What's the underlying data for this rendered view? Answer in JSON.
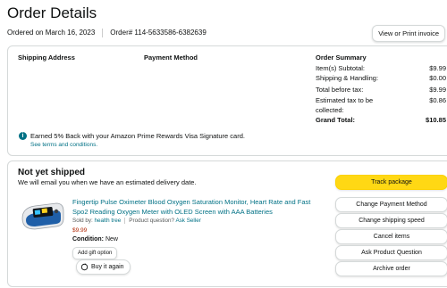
{
  "header": {
    "title": "Order Details",
    "ordered_on": "Ordered on March 16, 2023",
    "order_number": "Order# 114-5633586-6382639",
    "view_print_label": "View or Print invoice"
  },
  "details": {
    "shipping_address_label": "Shipping Address",
    "payment_method_label": "Payment Method",
    "order_summary_label": "Order Summary",
    "summary": [
      {
        "label": "Item(s) Subtotal:",
        "value": "$9.99"
      },
      {
        "label": "Shipping & Handling:",
        "value": "$0.00"
      },
      {
        "label": "Total before tax:",
        "value": "$9.99"
      },
      {
        "label": "Estimated tax to be collected:",
        "value": "$0.86"
      },
      {
        "label": "Grand Total:",
        "value": "$10.85"
      }
    ],
    "rewards_text": "Earned 5% Back with your Amazon Prime Rewards Visa Signature card.",
    "terms_link": "See terms and conditions."
  },
  "shipment": {
    "status_title": "Not yet shipped",
    "status_sub": "We will email you when we have an estimated delivery date.",
    "product": {
      "title": "Fingertip Pulse Oximeter Blood Oxygen Saturation Monitor, Heart Rate and Fast Spo2 Reading Oxygen Meter with OLED Screen with AAA Batteries",
      "sold_by_label": "Sold by:",
      "seller": "health tree",
      "question_label": "Product question?",
      "ask_seller": "Ask Seller",
      "price": "$9.99",
      "condition_label": "Condition:",
      "condition_value": "New"
    },
    "add_gift_label": "Add gift option",
    "buy_again_label": "Buy it again"
  },
  "actions": [
    "Track package",
    "Change Payment Method",
    "Change shipping speed",
    "Cancel items",
    "Ask Product Question",
    "Archive order"
  ],
  "colors": {
    "link": "#007185",
    "price": "#b12704",
    "primary_button": "#ffd814",
    "border": "#d5d9d9"
  },
  "icons": {
    "info": "info-icon",
    "buy_again": "cart-refresh-icon",
    "product": "pulse-oximeter-image"
  }
}
